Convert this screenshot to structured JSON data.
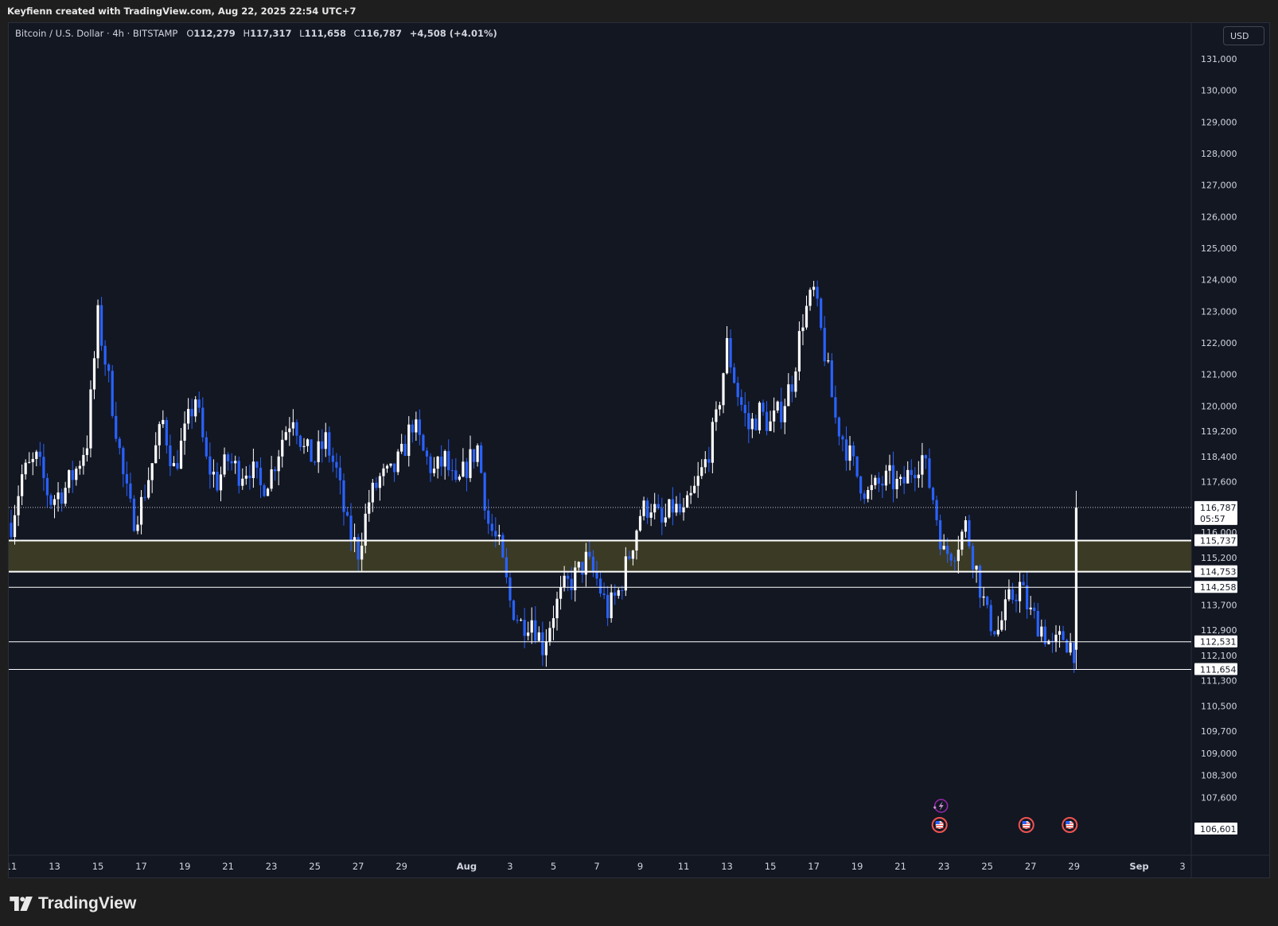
{
  "header": {
    "attribution": "Keyfienn created with TradingView.com, Aug 22, 2025 22:54 UTC+7"
  },
  "legend": {
    "symbol": "Bitcoin / U.S. Dollar · 4h · BITSTAMP",
    "o_label": "O",
    "o_value": "112,279",
    "h_label": "H",
    "h_value": "117,317",
    "l_label": "L",
    "l_value": "111,658",
    "c_label": "C",
    "c_value": "116,787",
    "change": "+4,508 (+4.01%)"
  },
  "currency_button": "USD",
  "footer": {
    "brand": "TradingView"
  },
  "colors": {
    "background": "#131722",
    "up_candle": "#ffffff",
    "down_candle": "#2962ff",
    "zone_fill": "#3b3a24",
    "level_line": "#ffffff"
  },
  "chart_data": {
    "type": "candlestick",
    "symbol": "BTCUSD",
    "timeframe": "4h",
    "exchange": "BITSTAMP",
    "ylim": [
      106100,
      131700
    ],
    "y_ticks": [
      {
        "v": 131000,
        "label": "131,000"
      },
      {
        "v": 130000,
        "label": "130,000"
      },
      {
        "v": 129000,
        "label": "129,000"
      },
      {
        "v": 128000,
        "label": "128,000"
      },
      {
        "v": 127000,
        "label": "127,000"
      },
      {
        "v": 126000,
        "label": "126,000"
      },
      {
        "v": 125000,
        "label": "125,000"
      },
      {
        "v": 124000,
        "label": "124,000"
      },
      {
        "v": 123000,
        "label": "123,000"
      },
      {
        "v": 122000,
        "label": "122,000"
      },
      {
        "v": 121000,
        "label": "121,000"
      },
      {
        "v": 120000,
        "label": "120,000"
      },
      {
        "v": 119200,
        "label": "119,200"
      },
      {
        "v": 118400,
        "label": "118,400"
      },
      {
        "v": 117600,
        "label": "117,600"
      },
      {
        "v": 116000,
        "label": "116,000"
      },
      {
        "v": 115200,
        "label": "115,200"
      },
      {
        "v": 113700,
        "label": "113,700"
      },
      {
        "v": 112900,
        "label": "112,900"
      },
      {
        "v": 112100,
        "label": "112,100"
      },
      {
        "v": 111300,
        "label": "111,300"
      },
      {
        "v": 110500,
        "label": "110,500"
      },
      {
        "v": 109700,
        "label": "109,700"
      },
      {
        "v": 109000,
        "label": "109,000"
      },
      {
        "v": 108300,
        "label": "108,300"
      },
      {
        "v": 107600,
        "label": "107,600"
      }
    ],
    "x_ticks": [
      {
        "d": 11,
        "label": "11"
      },
      {
        "d": 13,
        "label": "13"
      },
      {
        "d": 15,
        "label": "15"
      },
      {
        "d": 17,
        "label": "17"
      },
      {
        "d": 19,
        "label": "19"
      },
      {
        "d": 21,
        "label": "21"
      },
      {
        "d": 23,
        "label": "23"
      },
      {
        "d": 25,
        "label": "25"
      },
      {
        "d": 27,
        "label": "27"
      },
      {
        "d": 29,
        "label": "29"
      },
      {
        "d": 32,
        "label": "Aug",
        "bold": true
      },
      {
        "d": 34,
        "label": "3"
      },
      {
        "d": 36,
        "label": "5"
      },
      {
        "d": 38,
        "label": "7"
      },
      {
        "d": 40,
        "label": "9"
      },
      {
        "d": 42,
        "label": "11"
      },
      {
        "d": 44,
        "label": "13"
      },
      {
        "d": 46,
        "label": "15"
      },
      {
        "d": 48,
        "label": "17"
      },
      {
        "d": 50,
        "label": "19"
      },
      {
        "d": 52,
        "label": "21"
      },
      {
        "d": 54,
        "label": "23"
      },
      {
        "d": 56,
        "label": "25"
      },
      {
        "d": 58,
        "label": "27"
      },
      {
        "d": 60,
        "label": "29"
      },
      {
        "d": 63,
        "label": "Sep",
        "bold": true
      },
      {
        "d": 65,
        "label": "3"
      }
    ],
    "x_domain": [
      11,
      65
    ],
    "zone": {
      "from": 114753,
      "to": 115737
    },
    "horizontal_levels": [
      {
        "v": 115737,
        "label": "115,737",
        "weight": 2
      },
      {
        "v": 114753,
        "label": "114,753",
        "weight": 2
      },
      {
        "v": 114258,
        "label": "114,258",
        "weight": 1
      },
      {
        "v": 112531,
        "label": "112,531",
        "weight": 1
      },
      {
        "v": 111654,
        "label": "111,654",
        "weight": 1
      }
    ],
    "last_price": {
      "v": 116787,
      "label": "116,787",
      "countdown": "05:57"
    },
    "bottom_label": {
      "v": 106601,
      "label": "106,601"
    },
    "events": [
      {
        "d": 53.8,
        "type": "us-flag"
      },
      {
        "d": 57.8,
        "type": "us-flag"
      },
      {
        "d": 59.8,
        "type": "us-flag"
      }
    ],
    "path": [
      [
        11.0,
        116300
      ],
      [
        11.5,
        117800
      ],
      [
        12.2,
        118300
      ],
      [
        12.8,
        117000
      ],
      [
        13.5,
        117400
      ],
      [
        14.0,
        118000
      ],
      [
        14.5,
        118900
      ],
      [
        15.0,
        122800
      ],
      [
        15.4,
        121200
      ],
      [
        15.8,
        119500
      ],
      [
        16.2,
        117600
      ],
      [
        16.6,
        116400
      ],
      [
        17.0,
        116900
      ],
      [
        17.5,
        118200
      ],
      [
        18.0,
        119500
      ],
      [
        18.5,
        118000
      ],
      [
        19.0,
        119100
      ],
      [
        19.5,
        120300
      ],
      [
        20.0,
        118200
      ],
      [
        20.5,
        117600
      ],
      [
        21.0,
        118300
      ],
      [
        21.5,
        117900
      ],
      [
        22.0,
        118100
      ],
      [
        22.5,
        117400
      ],
      [
        23.0,
        117900
      ],
      [
        23.5,
        119000
      ],
      [
        24.0,
        119800
      ],
      [
        24.5,
        118600
      ],
      [
        25.0,
        118300
      ],
      [
        25.5,
        118900
      ],
      [
        26.0,
        117900
      ],
      [
        26.5,
        116100
      ],
      [
        27.0,
        115400
      ],
      [
        27.5,
        117000
      ],
      [
        28.0,
        117700
      ],
      [
        28.5,
        117800
      ],
      [
        29.0,
        118400
      ],
      [
        29.5,
        119500
      ],
      [
        30.0,
        118500
      ],
      [
        30.5,
        117900
      ],
      [
        31.0,
        118300
      ],
      [
        31.5,
        117300
      ],
      [
        32.0,
        118100
      ],
      [
        32.5,
        118700
      ],
      [
        33.0,
        116300
      ],
      [
        33.5,
        115500
      ],
      [
        34.0,
        113800
      ],
      [
        34.5,
        113100
      ],
      [
        35.0,
        113300
      ],
      [
        35.5,
        112400
      ],
      [
        36.0,
        113500
      ],
      [
        36.5,
        114200
      ],
      [
        37.0,
        114600
      ],
      [
        37.5,
        115100
      ],
      [
        38.0,
        114500
      ],
      [
        38.5,
        113500
      ],
      [
        39.0,
        114100
      ],
      [
        39.5,
        115300
      ],
      [
        40.0,
        116600
      ],
      [
        40.5,
        116900
      ],
      [
        41.0,
        116200
      ],
      [
        41.5,
        116800
      ],
      [
        42.0,
        116500
      ],
      [
        42.5,
        117300
      ],
      [
        43.0,
        118200
      ],
      [
        43.5,
        119500
      ],
      [
        44.0,
        121900
      ],
      [
        44.5,
        120400
      ],
      [
        45.0,
        119300
      ],
      [
        45.5,
        119800
      ],
      [
        46.0,
        119400
      ],
      [
        46.5,
        119900
      ],
      [
        47.0,
        120800
      ],
      [
        47.5,
        122800
      ],
      [
        48.0,
        123600
      ],
      [
        48.5,
        121700
      ],
      [
        49.0,
        119600
      ],
      [
        49.5,
        118700
      ],
      [
        50.0,
        117800
      ],
      [
        50.5,
        117200
      ],
      [
        51.0,
        117500
      ],
      [
        51.5,
        117700
      ],
      [
        52.0,
        117400
      ],
      [
        52.5,
        118000
      ],
      [
        53.0,
        118400
      ],
      [
        53.5,
        117100
      ],
      [
        54.0,
        115300
      ],
      [
        54.5,
        115500
      ],
      [
        55.0,
        116200
      ],
      [
        55.5,
        114800
      ],
      [
        56.0,
        113300
      ],
      [
        56.5,
        112900
      ],
      [
        57.0,
        113800
      ],
      [
        57.5,
        114300
      ],
      [
        58.0,
        113400
      ],
      [
        58.5,
        113000
      ],
      [
        59.0,
        112300
      ],
      [
        59.5,
        112700
      ],
      [
        60.0,
        112300
      ]
    ]
  }
}
